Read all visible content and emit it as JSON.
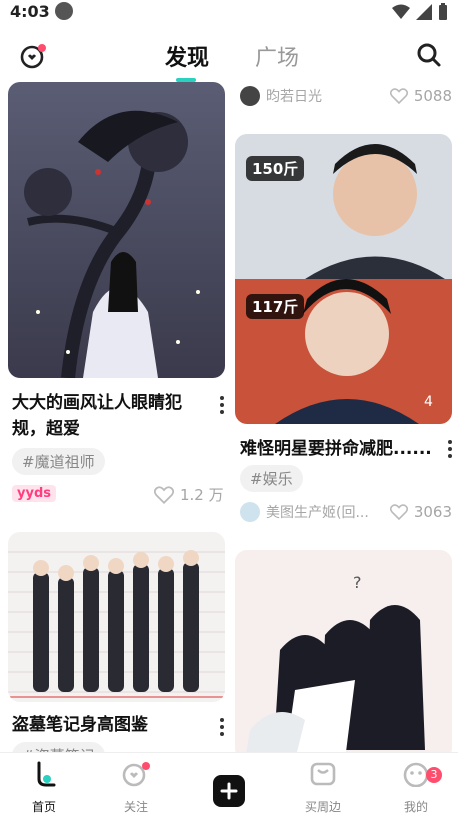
{
  "status_bar": {
    "time": "4:03"
  },
  "header": {
    "tab_discover": "发现",
    "tab_square": "广场"
  },
  "colors": {
    "accent": "#2ad0c0",
    "badge": "#ff4d6d",
    "yyds": "#ff3d7f"
  },
  "feed": {
    "partial_top_right": {
      "author": "昀若日光",
      "likes": "5088"
    },
    "card1": {
      "title": "大大的画风让人眼睛犯规，超爱",
      "tag": "#魔道祖师",
      "badge": "yyds",
      "likes": "1.2 万"
    },
    "card2": {
      "title": "难怪明星要拼命减肥......",
      "tag": "#娱乐",
      "author": "美图生产姬(回...",
      "likes": "3063",
      "image_count": "4",
      "overlay_top": "150斤",
      "overlay_bottom": "117斤"
    },
    "card3": {
      "title": "盗墓笔记身高图鉴",
      "tag": "#盗墓笔记"
    }
  },
  "bottom_nav": {
    "home": "首页",
    "follow": "关注",
    "shop": "买周边",
    "me": "我的",
    "me_badge": "3"
  }
}
